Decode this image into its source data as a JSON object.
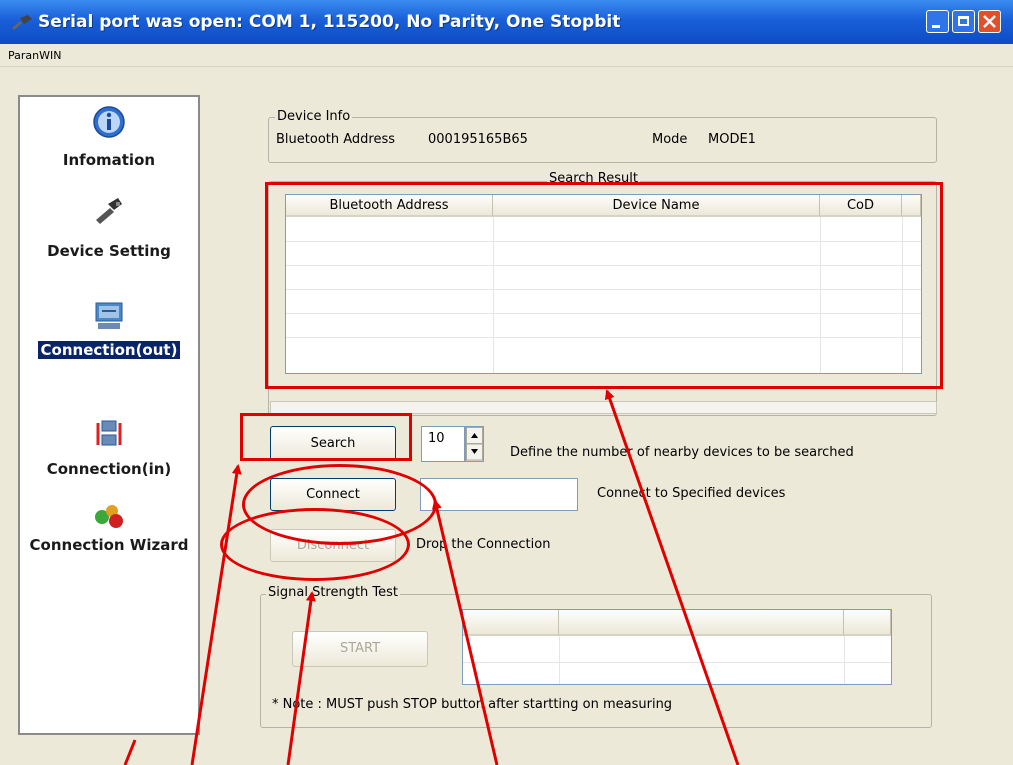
{
  "window": {
    "title": "Serial port was open: COM 1, 115200, No Parity, One Stopbit",
    "menu": "ParanWIN"
  },
  "sidebar": {
    "items": [
      {
        "label": "Infomation",
        "icon": "info-icon"
      },
      {
        "label": "Device Setting",
        "icon": "serial-device-icon"
      },
      {
        "label": "Connection(out)",
        "icon": "connection-out-icon",
        "active": true
      },
      {
        "label": "Connection(in)",
        "icon": "connection-in-icon"
      },
      {
        "label": "Connection Wizard",
        "icon": "wizard-icon"
      }
    ]
  },
  "device_info": {
    "group_title": "Device Info",
    "address_label": "Bluetooth Address",
    "address_value": "000195165B65",
    "mode_label": "Mode",
    "mode_value": "MODE1"
  },
  "search_result": {
    "group_title": "Search Result",
    "columns": [
      "Bluetooth Address",
      "Device Name",
      "CoD"
    ],
    "rows": []
  },
  "controls": {
    "search_label": "Search",
    "search_count": "10",
    "search_desc": "Define the number of nearby devices to be searched",
    "connect_label": "Connect",
    "connect_input": "",
    "connect_desc": "Connect to Specified devices",
    "disconnect_label": "Disconnect",
    "disconnect_desc": "Drop the Connection"
  },
  "signal_test": {
    "group_title": "Signal Strength Test",
    "start_label": "START",
    "note": "* Note : MUST push STOP button after startting on measuring"
  },
  "colors": {
    "title_bar": "#1a5fd8",
    "annotation": "#e00000",
    "active_item_bg": "#0a246a"
  }
}
